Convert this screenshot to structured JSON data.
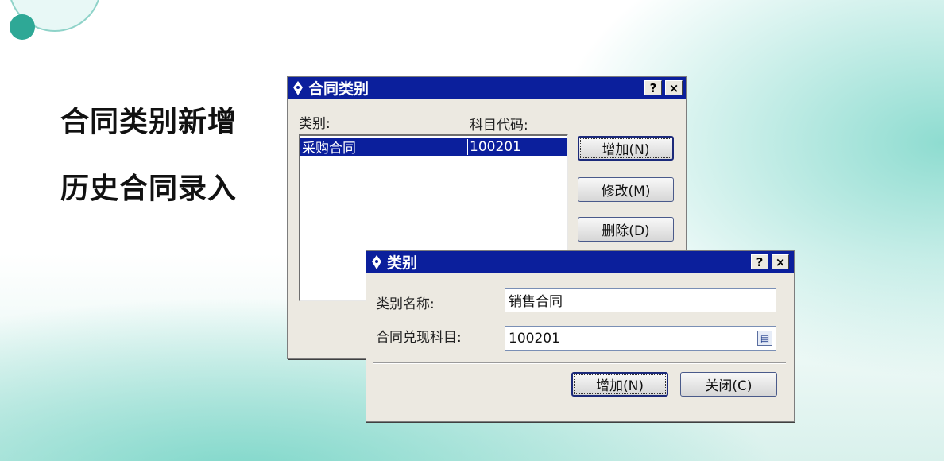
{
  "slide": {
    "line1": "合同类别新增",
    "line2": "历史合同录入"
  },
  "dialog_main": {
    "title": "合同类别",
    "help": "?",
    "close": "×",
    "col_category": "类别:",
    "col_code": "科目代码:",
    "rows": [
      {
        "category": "采购合同",
        "code": "100201"
      }
    ],
    "btn_add": "增加(N)",
    "btn_edit": "修改(M)",
    "btn_delete": "删除(D)"
  },
  "dialog_sub": {
    "title": "类别",
    "help": "?",
    "close": "×",
    "label_name": "类别名称:",
    "value_name": "销售合同",
    "label_account": "合同兑现科目:",
    "value_account": "100201",
    "btn_add": "增加(N)",
    "btn_close": "关闭(C)"
  },
  "colors": {
    "titlebar": "#0b1f9c",
    "selection": "#0b1f9c",
    "dialog_bg": "#ece9e1",
    "accent_teal": "#2ea896"
  },
  "icons": [
    "pen-nib-icon",
    "help-icon",
    "close-icon",
    "browse-icon"
  ]
}
